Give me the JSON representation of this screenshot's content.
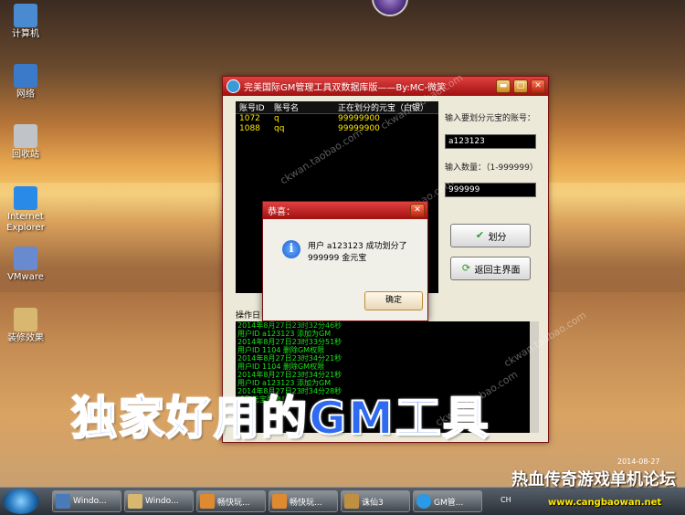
{
  "desktop": {
    "icons": [
      {
        "label": "计算机",
        "glyph": "computer-icon",
        "color": "#4a8ad0"
      },
      {
        "label": "网络",
        "glyph": "network-icon",
        "color": "#3a7ac8"
      },
      {
        "label": "回收站",
        "glyph": "recycle-bin-icon",
        "color": "#c0c4c8"
      },
      {
        "label": "Internet Explorer",
        "glyph": "ie-icon",
        "color": "#2a8ae8"
      },
      {
        "label": "VMware",
        "glyph": "vmware-icon",
        "color": "#6a8ad0"
      },
      {
        "label": "装修效果",
        "glyph": "folder-icon",
        "color": "#d8b870"
      }
    ]
  },
  "main_window": {
    "title": "完美国际GM管理工具双数据库版——By:MC-微笑",
    "minimize_glyph": "▬",
    "maximize_glyph": "□",
    "close_glyph": "✕",
    "account_list": {
      "headers": [
        "账号ID",
        "账号名",
        "正在划分的元宝（白银）"
      ],
      "rows": [
        [
          "1072",
          "q",
          "99999900"
        ],
        [
          "1088",
          "qq",
          "99999900"
        ]
      ]
    },
    "account_label": "输入要划分元宝的账号：",
    "account_value": "a123123",
    "quantity_label": "输入数量：（1-999999）",
    "quantity_value": "999999",
    "allocate_button": "划分",
    "back_button": "返回主界面",
    "log_label": "操作日",
    "log_lines": [
      "2014年8月27日23时32分46秒",
      "用户ID a123123 添加为GM",
      "2014年8月27日23时33分51秒",
      "用户ID 1104 删除GM权限",
      "2014年8月27日23时34分21秒",
      "用户ID 1104 删除GM权限",
      "2014年8月27日23时34分21秒",
      "用户ID a123123 添加为GM",
      "2014年8月27日23时34分28秒",
      "读取元宝列表！"
    ]
  },
  "dialog": {
    "title": "恭喜：",
    "message_line1": "用户 a123123 成功划分了",
    "message_line2": "999999 金元宝",
    "ok_button": "确定",
    "close_glyph": "✕"
  },
  "watermark": "ckwan.taobao.com",
  "banner": "独家好用的GM工具",
  "clock_date": "2014-08-27",
  "taskbar": {
    "items": [
      {
        "label": "Windo...",
        "color": "#4a7ab8"
      },
      {
        "label": "Windo...",
        "color": "#d8b870"
      },
      {
        "label": "畅快玩...",
        "color": "#e08a30"
      },
      {
        "label": "畅快玩...",
        "color": "#e08a30"
      },
      {
        "label": "诛仙3",
        "color": "#c09040"
      },
      {
        "label": "GM管...",
        "color": "#2a9ae8"
      }
    ],
    "tray_ch": "CH"
  },
  "forum": {
    "title": "热血传奇游戏单机论坛",
    "url": "www.cangbaowan.net"
  }
}
